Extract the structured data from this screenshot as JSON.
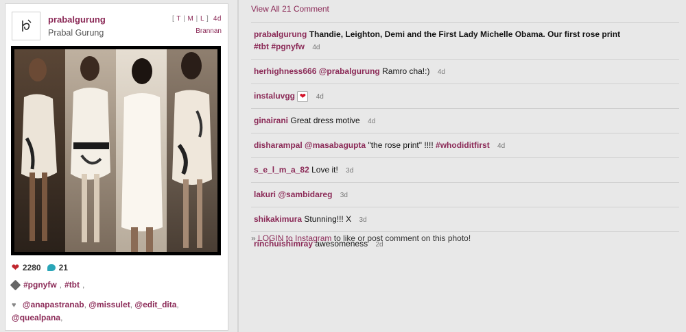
{
  "post": {
    "username": "prabalgurung",
    "full_name": "Prabal Gurung",
    "tml": {
      "open": "[",
      "t": "T",
      "m": "M",
      "l": "L",
      "close": "]",
      "pipe": "|"
    },
    "age": "4d",
    "filter": "Brannan",
    "likes": "2280",
    "comment_count": "21",
    "tags": [
      "#pgnyfw",
      "#tbt"
    ],
    "likers": [
      "@anapastranab",
      "@missulet",
      "@edit_dita",
      "@quealpana"
    ]
  },
  "comments_panel": {
    "view_all_label": "View All 21 Comment",
    "comments": [
      {
        "user": "prabalgurung",
        "text": "Thandie, Leighton, Demi and the First Lady Michelle Obama. Our first rose print",
        "hashtags": "#tbt #pgnyfw",
        "time": "4d"
      },
      {
        "user": "herhighness666",
        "mention": "@prabalgurung",
        "text": "Ramro cha!:)",
        "time": "4d"
      },
      {
        "user": "instaluvgg",
        "emoji": "heart",
        "time": "4d"
      },
      {
        "user": "ginairani",
        "text": "Great dress motive",
        "time": "4d"
      },
      {
        "user": "disharampal",
        "mention": "@masabagupta",
        "text": "\"the rose print\" !!!!",
        "hashtag": "#whodiditfirst",
        "time": "4d"
      },
      {
        "user": "s_e_l_m_a_82",
        "text": "Love it!",
        "time": "3d"
      },
      {
        "user": "lakuri",
        "mention": "@sambidareg",
        "time": "3d"
      },
      {
        "user": "shikakimura",
        "text": "Stunning!!! X",
        "time": "3d"
      },
      {
        "user": "rinchuishimray",
        "text": "awesomeness",
        "time": "2d"
      }
    ],
    "login_prefix": "»",
    "login_link": "LOGIN to Instagram",
    "login_suffix": "to like or post comment on this photo!"
  },
  "colors": {
    "accent": "#8b2a57",
    "heart": "#c0262e",
    "bubble": "#2aa6b8"
  },
  "icons": [
    "heart-icon",
    "comment-bubble-icon",
    "tag-icon",
    "small-heart-icon",
    "logo-icon"
  ]
}
